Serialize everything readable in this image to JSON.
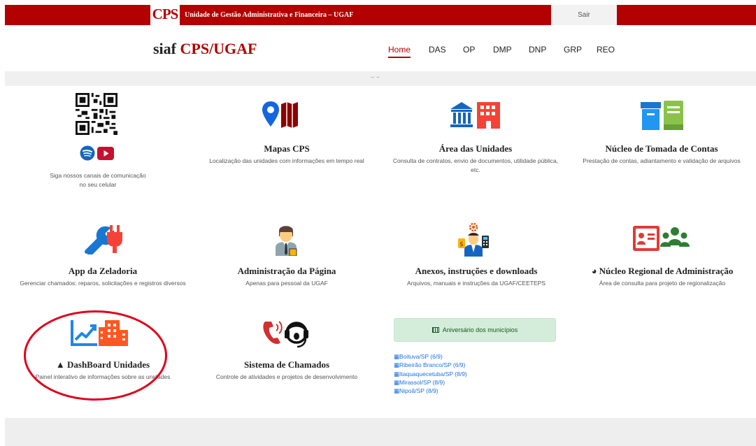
{
  "topbar": {
    "logo_text": "CPS",
    "title": "Unidade de Gestão Administrativa e Financeira – UGAF",
    "logout_label": "Sair",
    "color": "#b30000"
  },
  "brand": {
    "prefix": "siaf",
    "name": "CPS/UGAF"
  },
  "nav": [
    "Home",
    "DAS",
    "OP",
    "DMP",
    "DNP",
    "GRP",
    "REO"
  ],
  "greybar": {
    "arrows": "→→"
  },
  "social": {
    "line1": "Siga nossos canais de comunicação",
    "line2": "no seu celular",
    "icons": [
      "qr-code-icon",
      "spotify-icon",
      "youtube-icon"
    ]
  },
  "cards": [
    {
      "title": "Mapas CPS",
      "desc": "Localização das unidades com informações em tempo real",
      "icon": "map-marker-icon"
    },
    {
      "title": "Área das Unidades",
      "desc": "Consulta de contratos, envio de documentos, utilidade pública, etc.",
      "icon": "institution-icon"
    },
    {
      "title": "Núcleo de Tomada de Contas",
      "desc": "Prestação de contas, adiantamento e validação de arquivos",
      "icon": "archive-icon"
    },
    {
      "title": "App da Zeladoria",
      "desc": "Gerenciar chamados: reparos, solicitações e registros diversos",
      "icon": "wrench-plug-icon"
    },
    {
      "title": "Administração da Página",
      "desc": "Apenas para pessoal da UGAF",
      "icon": "admin-person-icon"
    },
    {
      "title": "Anexos, instruções e downloads",
      "desc": "Arquivos, manuais e instruções da UGAF/CEETEPS",
      "icon": "manager-settings-icon"
    },
    {
      "title": "Núcleo Regional de Administração",
      "desc": "Área de consulta para projeto de regionalização",
      "icon": "id-card-users-icon",
      "prefix_icon": "◕"
    },
    {
      "title": "DashBoard Unidades",
      "desc": "Painel interativo de informações sobre as unidades",
      "icon": "chart-building-icon",
      "prefix_icon": "▲"
    },
    {
      "title": "Sistema de Chamados",
      "desc": "Controle de atividades e projetos de desenvolvimento",
      "icon": "headset-phone-icon"
    }
  ],
  "aniversario": {
    "label": "Aniversário dos municípios",
    "items": [
      "Boituva/SP (6/9)",
      "Ribeirão Branco/SP (6/9)",
      "Itaquaquecetuba/SP (8/9)",
      "Mirassol/SP (8/9)",
      "Nipoã/SP (8/9)"
    ]
  },
  "colors": {
    "accent": "#b30000",
    "link": "#1a73e8",
    "highlight_circle": "#e0001a"
  }
}
